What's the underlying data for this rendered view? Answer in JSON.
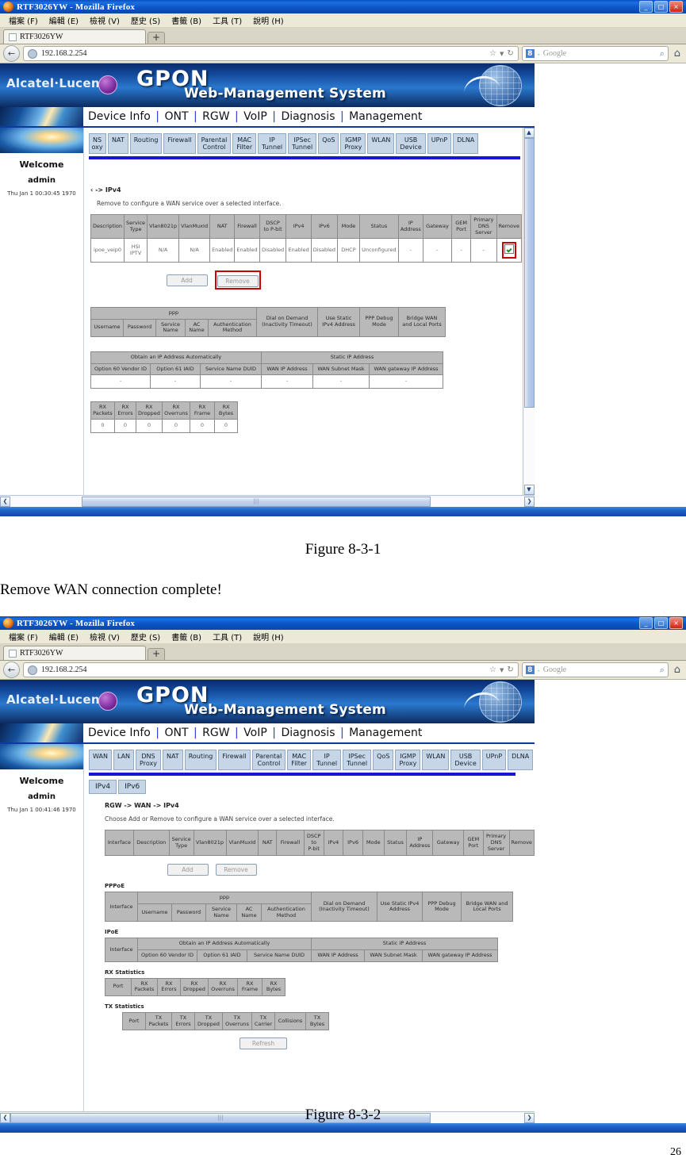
{
  "document": {
    "figure1_caption": "Figure 8-3-1",
    "paragraph": "Remove WAN connection complete!",
    "figure2_caption": "Figure 8-3-2",
    "page_number": "26"
  },
  "browser": {
    "window_title": "RTF3026YW - Mozilla Firefox",
    "minimize_label": "_",
    "maximize_label": "□",
    "close_label": "×",
    "menus": [
      "檔案 (F)",
      "編輯 (E)",
      "檢視 (V)",
      "歷史 (S)",
      "書籤 (B)",
      "工具 (T)",
      "說明 (H)"
    ],
    "tab_label": "RTF3026YW",
    "new_tab_label": "+",
    "back_label": "←",
    "url": "192.168.2.254",
    "bookmark_star": "☆",
    "dropdown_caret": "▼",
    "reload_label": "↻",
    "search_engine_badge": "8",
    "search_engine_dash": "-",
    "search_placeholder": "Google",
    "search_icon": "⌕",
    "home_icon": "⌂"
  },
  "gpon": {
    "brand": "Alcatel·Lucent",
    "title": "GPON",
    "subtitle": "Web-Management System",
    "menu_items": [
      "Device Info",
      "ONT",
      "RGW",
      "VoIP",
      "Diagnosis",
      "Management"
    ],
    "menu_separator": "|",
    "sidebar": {
      "welcome": "Welcome",
      "user": "admin"
    },
    "tabs_full": [
      "WAN",
      "LAN",
      "DNS\nProxy",
      "NAT",
      "Routing",
      "Firewall",
      "Parental\nControl",
      "MAC\nFilter",
      "IP\nTunnel",
      "IPSec\nTunnel",
      "QoS",
      "IGMP\nProxy",
      "WLAN",
      "USB\nDevice",
      "UPnP",
      "DLNA"
    ],
    "subtabs": [
      "IPv4",
      "IPv6"
    ],
    "buttons": {
      "add": "Add",
      "remove": "Remove",
      "refresh": "Refresh"
    },
    "scroll": {
      "up": "▲",
      "down": "▼",
      "left": "❮",
      "right": "❯",
      "grip": "|||"
    }
  },
  "screen1": {
    "clock": "Thu Jan 1 00:30:45 1970",
    "tabs_visible": [
      "NS\noxy",
      "NAT",
      "Routing",
      "Firewall",
      "Parental\nControl",
      "MAC\nFilter",
      "IP\nTunnel",
      "IPSec\nTunnel",
      "QoS",
      "IGMP\nProxy",
      "WLAN",
      "USB\nDevice",
      "UPnP",
      "DLNA"
    ],
    "breadcrumb": "‹ -> IPv4",
    "hint": "Remove to configure a WAN service over a selected interface.",
    "wan_table": {
      "headers": [
        "Description",
        "Service\nType",
        "Vlan8021p",
        "VlanMuxId",
        "NAT",
        "Firewall",
        "DSCP\nto P-bit",
        "IPv4",
        "IPv6",
        "Mode",
        "Status",
        "IP\nAddress",
        "Gateway",
        "GEM\nPort",
        "Primary\nDNS\nServer",
        "Remove"
      ],
      "row": [
        "ipoe_veip0",
        "HSI\nIPTV",
        "N/A",
        "N/A",
        "Enabled",
        "Enabled",
        "Disabled",
        "Enabled",
        "Disabled",
        "DHCP",
        "Unconfigured",
        "-",
        "-",
        "-",
        "-"
      ],
      "remove_checked": true
    },
    "ppp_table": {
      "group_ppp": "ppp",
      "headers_sub": [
        "Username",
        "Password",
        "Service\nName",
        "AC\nName",
        "Authentication\nMethod"
      ],
      "headers_right": [
        "Dial on Demand\n(Inactivity Timeout)",
        "Use Static\nIPv4 Address",
        "PPP Debug\nMode",
        "Bridge WAN\nand Local Ports"
      ]
    },
    "ip_table": {
      "group_auto": "Obtain an IP Address Automatically",
      "group_static": "Static IP Address",
      "headers": [
        "Option 60 Vendor ID",
        "Option 61 IAID",
        "Service Name DUID",
        "WAN IP Address",
        "WAN Subnet Mask",
        "WAN gateway IP Address"
      ],
      "row": [
        "-",
        "-",
        "-",
        "-",
        "-",
        "-"
      ]
    },
    "rx_table": {
      "headers": [
        "RX\nPackets",
        "RX\nErrors",
        "RX\nDropped",
        "RX\nOverruns",
        "RX\nFrame",
        "RX\nBytes"
      ],
      "row": [
        "0",
        "0",
        "0",
        "0",
        "0",
        "0"
      ]
    }
  },
  "screen2": {
    "clock": "Thu Jan 1 00:41:46 1970",
    "breadcrumb": "RGW -> WAN -> IPv4",
    "hint": "Choose Add or Remove to configure a WAN service over a selected interface.",
    "wan_table": {
      "headers": [
        "Interface",
        "Description",
        "Service\nType",
        "Vlan8021p",
        "VlanMuxId",
        "NAT",
        "Firewall",
        "DSCP\nto\nP-bit",
        "IPv4",
        "IPv6",
        "Mode",
        "Status",
        "IP\nAddress",
        "Gateway",
        "GEM\nPort",
        "Primary\nDNS\nServer",
        "Remove"
      ]
    },
    "pppoe": {
      "label": "PPPoE",
      "interface": "Interface",
      "group_ppp": "ppp",
      "headers_sub": [
        "Username",
        "Password",
        "Service\nName",
        "AC\nName",
        "Authentication\nMethod"
      ],
      "headers_right": [
        "Dial on Demand\n(Inactivity Timeout)",
        "Use Static IPv4\nAddress",
        "PPP Debug\nMode",
        "Bridge WAN and\nLocal Ports"
      ]
    },
    "ipoe": {
      "label": "IPoE",
      "interface": "Interface",
      "group_auto": "Obtain an IP Address Automatically",
      "group_static": "Static IP Address",
      "headers": [
        "Option 60 Vendor ID",
        "Option 61 IAID",
        "Service Name DUID",
        "WAN IP Address",
        "WAN Subnet Mask",
        "WAN gateway IP Address"
      ]
    },
    "rx_stats": {
      "label": "RX Statistics",
      "headers": [
        "Port",
        "RX\nPackets",
        "RX\nErrors",
        "RX\nDropped",
        "RX\nOverruns",
        "RX\nFrame",
        "RX\nBytes"
      ]
    },
    "tx_stats": {
      "label": "TX Statistics",
      "headers": [
        "Port",
        "TX\nPackets",
        "TX\nErrors",
        "TX\nDropped",
        "TX\nOverruns",
        "TX\nCarrier",
        "Collisions",
        "TX\nBytes"
      ]
    }
  }
}
